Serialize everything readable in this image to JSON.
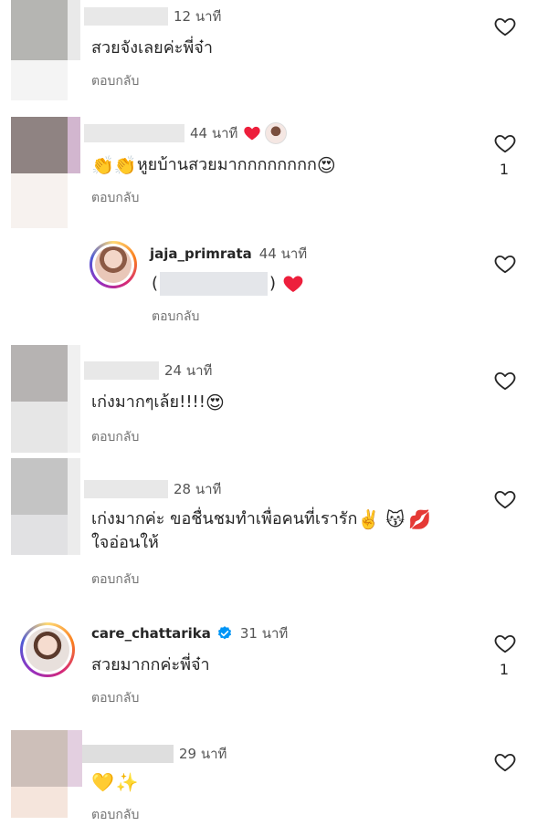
{
  "reply_label": "ตอบกลับ",
  "comments": [
    {
      "time": "12 นาที",
      "text": "สวยจังเลยค่ะพี่จ๋า"
    },
    {
      "time": "44 นาที",
      "text": "หูยบ้านสวยมากกกกกกกก",
      "likes": "1"
    },
    {
      "username": "jaja_primrata",
      "time": "44 นาที",
      "text_open": "(",
      "text_close": ")"
    },
    {
      "time": "24 นาที",
      "text": "เก่งมากๆเล้ย!!!!"
    },
    {
      "time": "28 นาที",
      "text_line1": "เก่งมากค่ะ ขอชื่นชมทำเพื่อคนที่เรารัก",
      "text_line2": "ใจอ่อนให้"
    },
    {
      "username": "care_chattarika",
      "time": "31 นาที",
      "text": "สวยมากกค่ะพี่จ๋า",
      "likes": "1"
    },
    {
      "time": "29 นาที"
    }
  ],
  "icons": {
    "heart": "heart-outline",
    "filled_heart": "red-heart",
    "verified": "verified-badge"
  },
  "colors": {
    "red_heart": "#ed1f3c",
    "verified": "#0095f6",
    "muted_text": "#737373"
  }
}
